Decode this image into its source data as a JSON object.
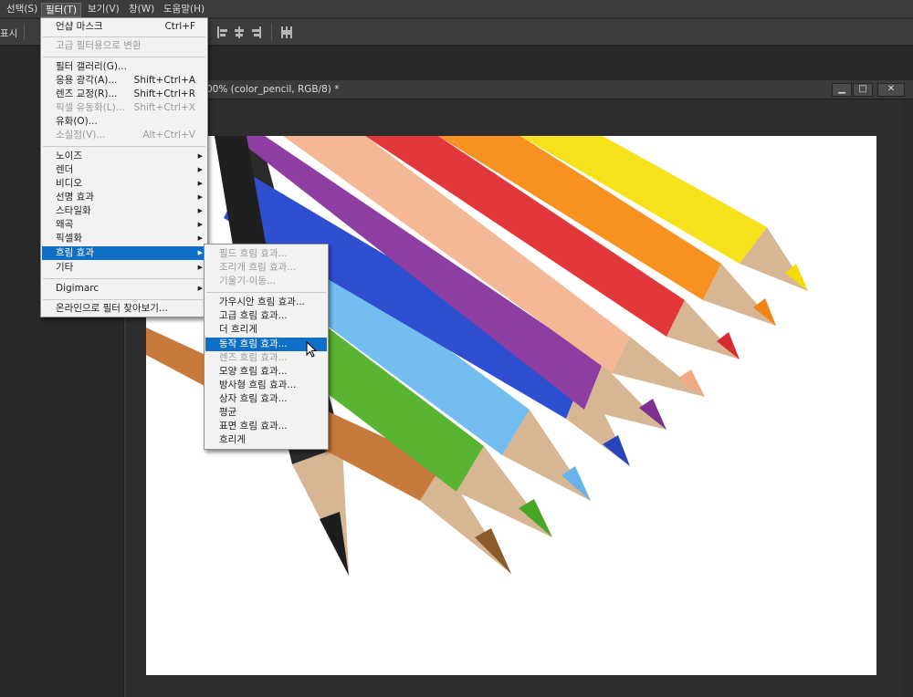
{
  "menubar": {
    "items": [
      {
        "label": "선택(S)"
      },
      {
        "label": "필터(T)"
      },
      {
        "label": "보기(V)"
      },
      {
        "label": "창(W)"
      },
      {
        "label": "도움말(H)"
      }
    ]
  },
  "optionsbar": {
    "label": "표시"
  },
  "document": {
    "title": "00% (color_pencil, RGB/8) *",
    "btn_minimize": "▁",
    "btn_maximize": "□",
    "btn_close": "✕"
  },
  "filter_menu": {
    "items": [
      {
        "label": "언샵 마스크",
        "shortcut": "Ctrl+F"
      },
      {
        "label": "고급 필터용으로 변환"
      },
      {
        "label": "필터 갤러리(G)..."
      },
      {
        "label": "응용 광각(A)...",
        "shortcut": "Shift+Ctrl+A"
      },
      {
        "label": "렌즈 교정(R)...",
        "shortcut": "Shift+Ctrl+R"
      },
      {
        "label": "픽셀 유동화(L)...",
        "shortcut": "Shift+Ctrl+X"
      },
      {
        "label": "유화(O)..."
      },
      {
        "label": "소실점(V)...",
        "shortcut": "Alt+Ctrl+V"
      },
      {
        "label": "노이즈"
      },
      {
        "label": "렌더"
      },
      {
        "label": "비디오"
      },
      {
        "label": "선명 효과"
      },
      {
        "label": "스타일화"
      },
      {
        "label": "왜곡"
      },
      {
        "label": "픽셀화"
      },
      {
        "label": "흐림 효과"
      },
      {
        "label": "기타"
      },
      {
        "label": "Digimarc"
      },
      {
        "label": "온라인으로 필터 찾아보기..."
      }
    ]
  },
  "blur_submenu": {
    "items": [
      {
        "label": "필드 흐림 효과..."
      },
      {
        "label": "조리개 흐림 효과..."
      },
      {
        "label": "기울기-이동..."
      },
      {
        "label": "가우시안 흐림 효과..."
      },
      {
        "label": "고급 흐림 효과..."
      },
      {
        "label": "더 흐리게"
      },
      {
        "label": "동작 흐림 효과..."
      },
      {
        "label": "렌즈 흐림 효과..."
      },
      {
        "label": "모양 흐림 효과..."
      },
      {
        "label": "방사형 흐림 효과..."
      },
      {
        "label": "상자 흐림 효과..."
      },
      {
        "label": "평균"
      },
      {
        "label": "표면 흐림 효과..."
      },
      {
        "label": "흐리게"
      }
    ]
  },
  "pencil_colors": {
    "purple": "#8e3ea3",
    "peach": "#f5b896",
    "red": "#e2373b",
    "orange": "#f79221",
    "yellow": "#f6e21a",
    "blue": "#2e4fcf",
    "lightblue": "#74bdf0",
    "green": "#59b432",
    "brown": "#c67a3c",
    "black": "#1d1d1d",
    "wood": "#d7b693"
  }
}
